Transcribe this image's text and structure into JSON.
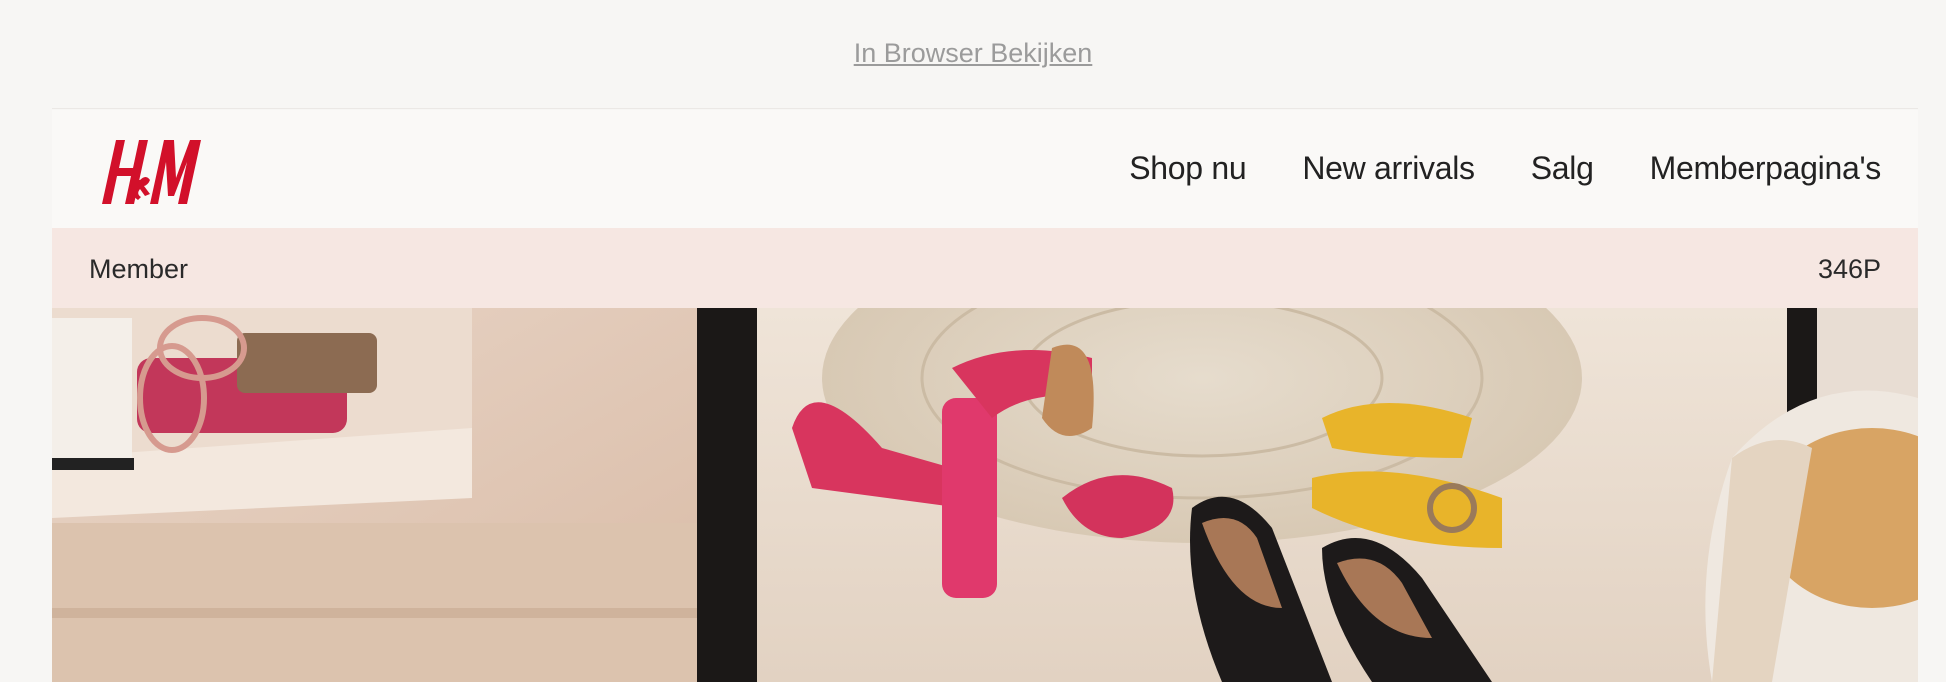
{
  "preheader": {
    "view_in_browser": "In Browser Bekijken"
  },
  "brand": {
    "logo_text": "H&M",
    "logo_color": "#d2102a"
  },
  "nav": {
    "items": [
      "Shop nu",
      "New arrivals",
      "Salg",
      "Memberpagina's"
    ]
  },
  "member_bar": {
    "label": "Member",
    "points": "346P",
    "background": "#f6e7e2"
  },
  "hero": {
    "image_subject": "shoes-on-floor-photo"
  }
}
